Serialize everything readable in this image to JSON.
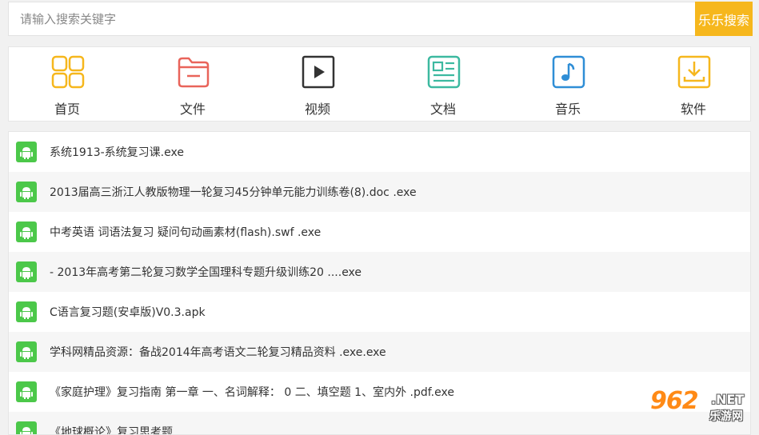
{
  "search": {
    "placeholder": "请输入搜索关键字",
    "value": "",
    "button_label": "乐乐搜索"
  },
  "nav": {
    "items": [
      {
        "label": "首页",
        "icon": "grid-icon",
        "color": "#f6b71d"
      },
      {
        "label": "文件",
        "icon": "folder-icon",
        "color": "#e9645a"
      },
      {
        "label": "视频",
        "icon": "play-icon",
        "color": "#333333"
      },
      {
        "label": "文档",
        "icon": "document-icon",
        "color": "#3cb9a0"
      },
      {
        "label": "音乐",
        "icon": "music-icon",
        "color": "#2f8ed6"
      },
      {
        "label": "软件",
        "icon": "download-icon",
        "color": "#f6b71d"
      }
    ]
  },
  "results": {
    "items": [
      {
        "title": "系统1913-系统复习课.exe",
        "icon": "android-icon"
      },
      {
        "title": "2013届高三浙江人教版物理一轮复习45分钟单元能力训练卷(8).doc .exe",
        "icon": "android-icon"
      },
      {
        "title": "中考英语 词语法复习 疑问句动画素材(flash).swf .exe",
        "icon": "android-icon"
      },
      {
        "title": "- 2013年高考第二轮复习数学全国理科专题升级训练20 ....exe",
        "icon": "android-icon"
      },
      {
        "title": "C语言复习题(安卓版)V0.3.apk",
        "icon": "android-icon"
      },
      {
        "title": "学科网精品资源：备战2014年高考语文二轮复习精品资料 .exe.exe",
        "icon": "android-icon"
      },
      {
        "title": "《家庭护理》复习指南 第一章 一、名词解释： 0 二、填空题 1、室内外 .pdf.exe",
        "icon": "android-icon"
      },
      {
        "title": "《地球概论》复习思考题",
        "icon": "android-icon"
      }
    ]
  },
  "watermark": {
    "number": "962",
    "domain": ".NET",
    "site_name": "乐游网"
  },
  "colors": {
    "accent": "#f6b71d",
    "android_green": "#4cc84a"
  }
}
